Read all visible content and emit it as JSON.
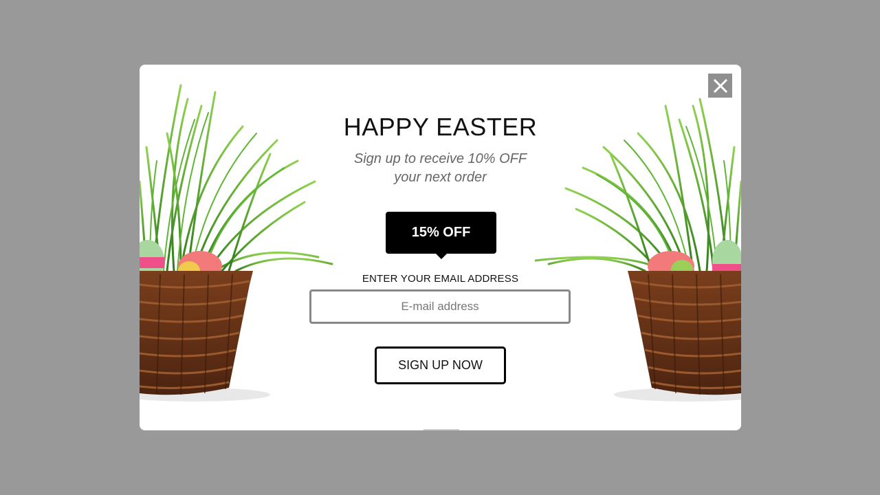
{
  "popup": {
    "title": "HAPPY EASTER",
    "subtitle_line1": "Sign up to receive 10% OFF",
    "subtitle_line2": "your next order",
    "badge": "15% OFF",
    "email_label": "ENTER YOUR EMAIL ADDRESS",
    "email_placeholder": "E-mail address",
    "email_value": "",
    "signup_label": "SIGN UP NOW",
    "close_icon": "close-icon"
  },
  "colors": {
    "overlay": "#999999",
    "modal_bg": "#ffffff",
    "badge_bg": "#000000",
    "close_bg": "#8f8f8f",
    "input_border": "#888888"
  },
  "images": {
    "left": "easter-basket-grass-eggs-image",
    "right": "easter-basket-grass-eggs-image"
  }
}
